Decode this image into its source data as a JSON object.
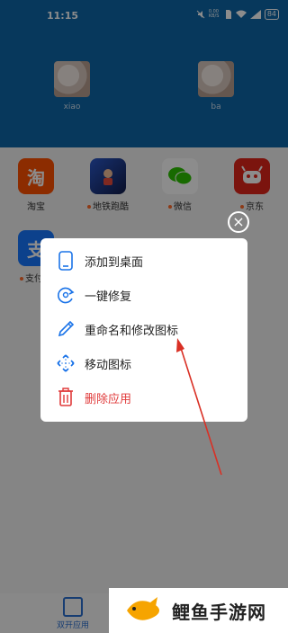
{
  "status_bar": {
    "time": "11:15",
    "network_speed": "0.00\nKB/S",
    "battery": "84"
  },
  "accounts": [
    {
      "name": "xiao"
    },
    {
      "name": "ba"
    }
  ],
  "apps": [
    {
      "label": "淘宝",
      "icon": "taobao-icon",
      "color": "#ff5000",
      "glyph": "淘",
      "dot": false
    },
    {
      "label": "地铁跑酷",
      "icon": "subway-surfers-icon",
      "color": "#1d3a8a",
      "glyph": "",
      "dot": true
    },
    {
      "label": "微信",
      "icon": "wechat-icon",
      "color": "#ffffff",
      "glyph": "",
      "dot": true
    },
    {
      "label": "京东",
      "icon": "jd-icon",
      "color": "#e1251b",
      "glyph": "",
      "dot": true
    },
    {
      "label": "支付宝",
      "icon": "alipay-icon",
      "color": "#1677ff",
      "glyph": "支",
      "dot": true
    }
  ],
  "context_menu": {
    "items": [
      {
        "label": "添加到桌面",
        "icon": "phone-icon",
        "danger": false
      },
      {
        "label": "一键修复",
        "icon": "repair-icon",
        "danger": false
      },
      {
        "label": "重命名和修改图标",
        "icon": "pencil-icon",
        "danger": false
      },
      {
        "label": "移动图标",
        "icon": "move-icon",
        "danger": false
      },
      {
        "label": "删除应用",
        "icon": "trash-icon",
        "danger": true
      }
    ]
  },
  "bottom_nav": {
    "label": "双开应用"
  },
  "watermark": {
    "text": "鲤鱼手游网"
  },
  "colors": {
    "accent": "#1a73e8",
    "danger": "#e03a3a",
    "header": "#0d66a8",
    "annotation_arrow": "#d93025"
  }
}
